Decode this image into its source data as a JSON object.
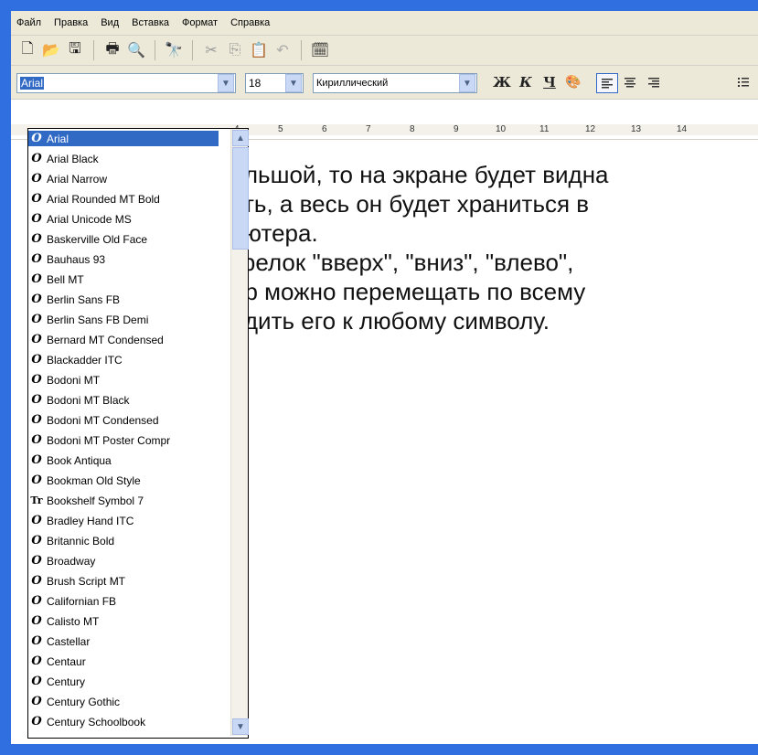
{
  "menu": [
    "Файл",
    "Правка",
    "Вид",
    "Вставка",
    "Формат",
    "Справка"
  ],
  "toolbar_icons": [
    "new-document-icon",
    "open-folder-icon",
    "save-icon",
    "print-icon",
    "print-preview-icon",
    "find-icon",
    "cut-icon",
    "copy-icon",
    "paste-icon",
    "undo-icon",
    "insert-datetime-icon"
  ],
  "format": {
    "font_name": "Arial",
    "font_size": "18",
    "script": "Кириллический",
    "bold": "Ж",
    "italic": "К",
    "underline": "Ч"
  },
  "ruler_ticks": [
    "4",
    "5",
    "6",
    "7",
    "8",
    "9",
    "10",
    "11",
    "12",
    "13",
    "14"
  ],
  "document_lines": [
    "ольшой, то на экране будет видна",
    "сть, а весь он будет храниться в",
    "ьютера.",
    "трелок \"вверх\", \"вниз\", \"влево\",",
    "ор можно перемещать по всему",
    "одить его к любому символу."
  ],
  "font_list": [
    {
      "name": "Arial",
      "type": "opentype"
    },
    {
      "name": "Arial Black",
      "type": "opentype"
    },
    {
      "name": "Arial Narrow",
      "type": "opentype"
    },
    {
      "name": "Arial Rounded MT Bold",
      "type": "opentype"
    },
    {
      "name": "Arial Unicode MS",
      "type": "opentype"
    },
    {
      "name": "Baskerville Old Face",
      "type": "opentype"
    },
    {
      "name": "Bauhaus 93",
      "type": "opentype"
    },
    {
      "name": "Bell MT",
      "type": "opentype"
    },
    {
      "name": "Berlin Sans FB",
      "type": "opentype"
    },
    {
      "name": "Berlin Sans FB Demi",
      "type": "opentype"
    },
    {
      "name": "Bernard MT Condensed",
      "type": "opentype"
    },
    {
      "name": "Blackadder ITC",
      "type": "opentype"
    },
    {
      "name": "Bodoni MT",
      "type": "opentype"
    },
    {
      "name": "Bodoni MT Black",
      "type": "opentype"
    },
    {
      "name": "Bodoni MT Condensed",
      "type": "opentype"
    },
    {
      "name": "Bodoni MT Poster Compr",
      "type": "opentype"
    },
    {
      "name": "Book Antiqua",
      "type": "opentype"
    },
    {
      "name": "Bookman Old Style",
      "type": "opentype"
    },
    {
      "name": "Bookshelf Symbol 7",
      "type": "truetype"
    },
    {
      "name": "Bradley Hand ITC",
      "type": "opentype"
    },
    {
      "name": "Britannic Bold",
      "type": "opentype"
    },
    {
      "name": "Broadway",
      "type": "opentype"
    },
    {
      "name": "Brush Script MT",
      "type": "opentype"
    },
    {
      "name": "Californian FB",
      "type": "opentype"
    },
    {
      "name": "Calisto MT",
      "type": "opentype"
    },
    {
      "name": "Castellar",
      "type": "opentype"
    },
    {
      "name": "Centaur",
      "type": "opentype"
    },
    {
      "name": "Century",
      "type": "opentype"
    },
    {
      "name": "Century Gothic",
      "type": "opentype"
    },
    {
      "name": "Century Schoolbook",
      "type": "opentype"
    }
  ],
  "selected_font_index": 0,
  "icons": {
    "opentype": "O",
    "truetype": "Tr"
  },
  "colors": {
    "background": "#2f6fe0",
    "selection": "#316ac5"
  }
}
